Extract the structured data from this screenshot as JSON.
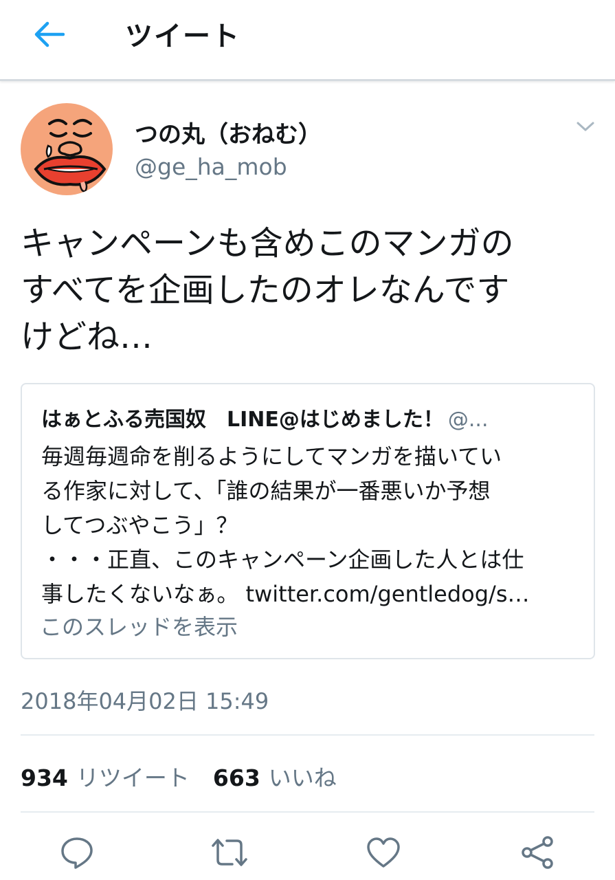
{
  "header": {
    "title": "ツイート",
    "back_icon": "arrow-left-icon"
  },
  "colors": {
    "accent": "#1da1f2",
    "icon_gray": "#657786",
    "text": "#14171a",
    "avatar_bg": "#f5a47b",
    "avatar_lips": "#e8402f"
  },
  "tweet": {
    "author_name": "つの丸（おねむ）",
    "author_handle": "@ge_ha_mob",
    "text_lines": [
      "キャンペーンも含めこのマンガの",
      "すべてを企画したのオレなんです",
      "けどね…"
    ],
    "timestamp": "2018年04月02日 15:49"
  },
  "quote": {
    "name": "はぁとふる売国奴　LINE@はじめました！",
    "handle": "@...",
    "lines": [
      "毎週毎週命を削るようにしてマンガを描いてい",
      "る作家に対して、「誰の結果が一番悪いか予想",
      "してつぶやこう」？",
      "・・・正直、このキャンペーン企画した人とは仕",
      "事したくないなぁ。 twitter.com/gentledog/s…"
    ],
    "thread_link": "このスレッドを表示"
  },
  "stats": {
    "retweets_count": "934",
    "retweets_label": "リツイート",
    "likes_count": "663",
    "likes_label": "いいね"
  },
  "actions": {
    "reply_icon": "reply-icon",
    "retweet_icon": "retweet-icon",
    "like_icon": "heart-icon",
    "share_icon": "share-icon"
  }
}
